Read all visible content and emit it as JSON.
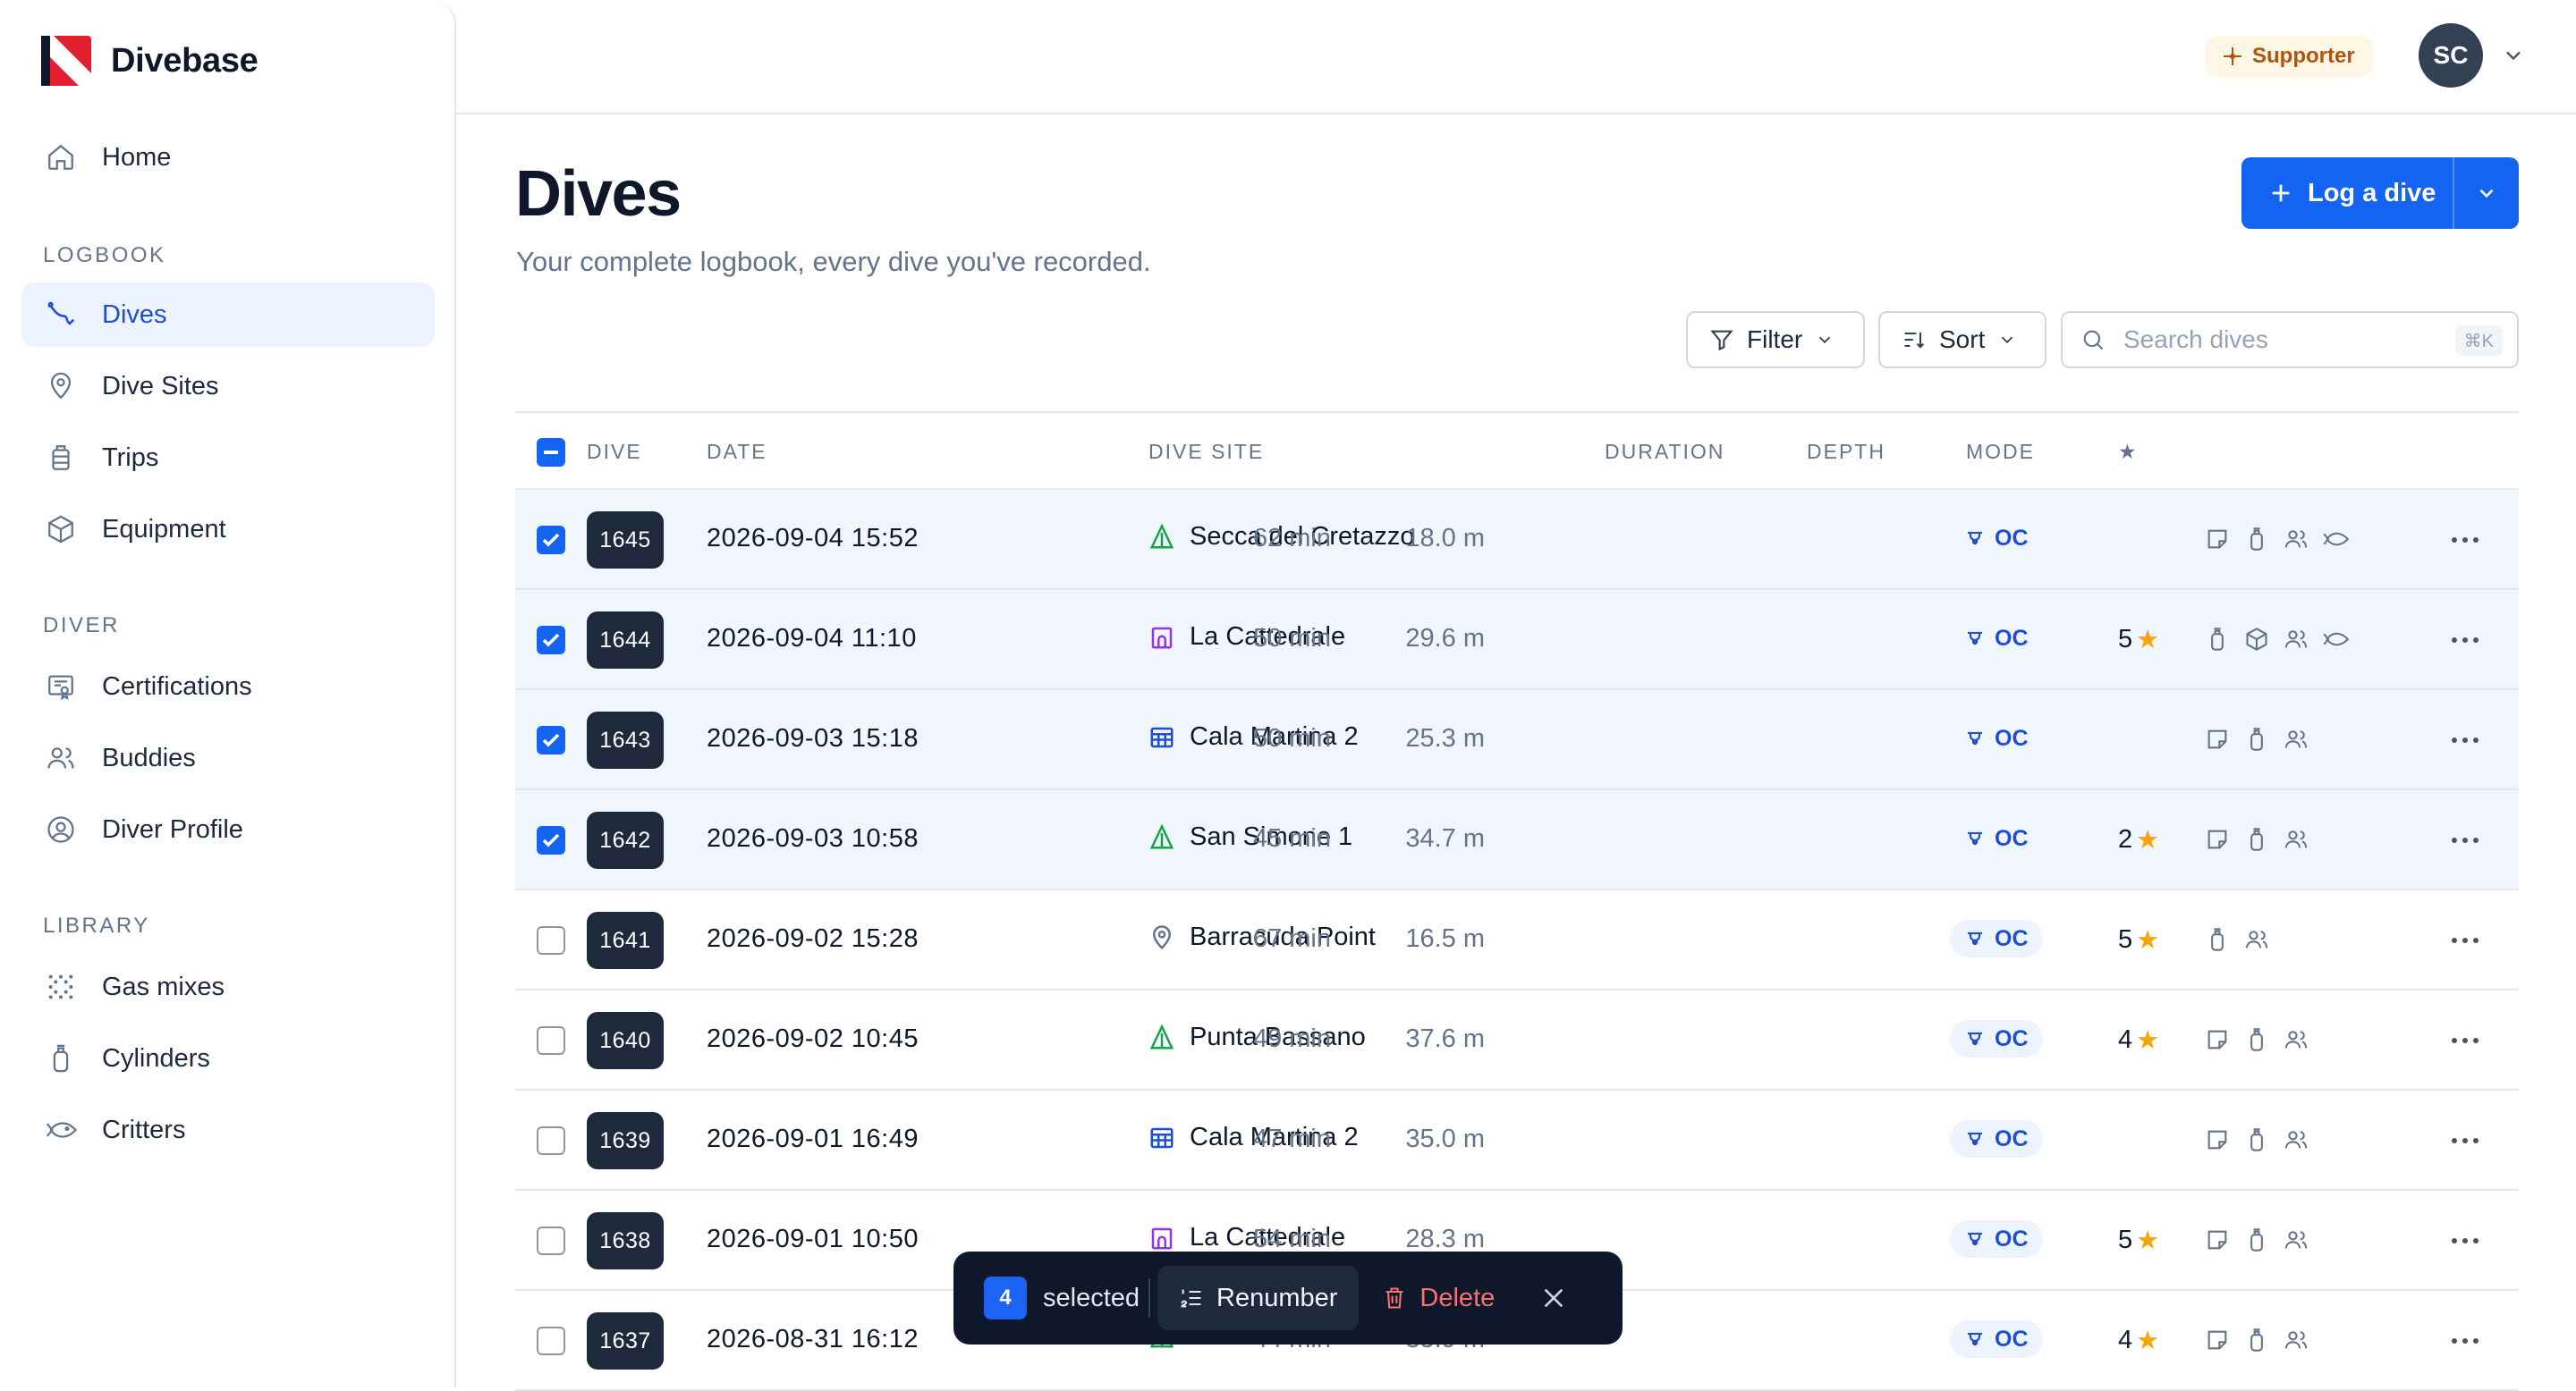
{
  "app": {
    "name": "Divebase"
  },
  "sidebar": {
    "home": "Home",
    "sections": {
      "logbook": "LOGBOOK",
      "diver": "DIVER",
      "library": "LIBRARY"
    },
    "items": [
      {
        "label": "Dives",
        "icon": "dives-icon"
      },
      {
        "label": "Dive Sites",
        "icon": "pin-icon"
      },
      {
        "label": "Trips",
        "icon": "luggage-icon"
      },
      {
        "label": "Equipment",
        "icon": "box-icon"
      },
      {
        "label": "Certifications",
        "icon": "certificate-icon"
      },
      {
        "label": "Buddies",
        "icon": "users-icon"
      },
      {
        "label": "Diver Profile",
        "icon": "user-circle-icon"
      },
      {
        "label": "Gas mixes",
        "icon": "bubbles-icon"
      },
      {
        "label": "Cylinders",
        "icon": "cylinder-icon"
      },
      {
        "label": "Critters",
        "icon": "fish-icon"
      }
    ]
  },
  "header": {
    "badge": "Supporter",
    "avatar_initials": "SC"
  },
  "page": {
    "title": "Dives",
    "subtitle": "Your complete logbook, every dive you've recorded.",
    "log_button": "Log a dive",
    "filter": "Filter",
    "sort": "Sort",
    "search_placeholder": "Search dives",
    "search_shortcut": "⌘K"
  },
  "table": {
    "columns": {
      "dive": "DIVE",
      "date": "DATE",
      "site": "DIVE SITE",
      "duration": "DURATION",
      "depth": "DEPTH",
      "mode": "MODE",
      "rating": "★"
    },
    "rows": [
      {
        "selected": true,
        "number": "1645",
        "date": "2026-09-04 15:52",
        "site_type": "reef",
        "site": "Secca del Cretazzo",
        "duration": "62 min",
        "depth": "18.0 m",
        "mode": "OC",
        "mode_pill": false,
        "rating": "",
        "icons": [
          "note",
          "cylinder",
          "buddies",
          "critters"
        ]
      },
      {
        "selected": true,
        "number": "1644",
        "date": "2026-09-04 11:10",
        "site_type": "cave",
        "site": "La Cattedrale",
        "duration": "50 min",
        "depth": "29.6 m",
        "mode": "OC",
        "mode_pill": false,
        "rating": "5",
        "icons": [
          "cylinder",
          "equipment",
          "buddies",
          "critters"
        ]
      },
      {
        "selected": true,
        "number": "1643",
        "date": "2026-09-03 15:18",
        "site_type": "wreck",
        "site": "Cala Martina 2",
        "duration": "50 min",
        "depth": "25.3 m",
        "mode": "OC",
        "mode_pill": false,
        "rating": "",
        "icons": [
          "note",
          "cylinder",
          "buddies"
        ]
      },
      {
        "selected": true,
        "number": "1642",
        "date": "2026-09-03 10:58",
        "site_type": "reef",
        "site": "San Simone 1",
        "duration": "45 min",
        "depth": "34.7 m",
        "mode": "OC",
        "mode_pill": false,
        "rating": "2",
        "icons": [
          "note",
          "cylinder",
          "buddies"
        ]
      },
      {
        "selected": false,
        "number": "1641",
        "date": "2026-09-02 15:28",
        "site_type": "pin",
        "site": "Barracuda Point",
        "duration": "67 min",
        "depth": "16.5 m",
        "mode": "OC",
        "mode_pill": true,
        "rating": "5",
        "icons": [
          "cylinder",
          "buddies"
        ]
      },
      {
        "selected": false,
        "number": "1640",
        "date": "2026-09-02 10:45",
        "site_type": "reef",
        "site": "Punta Bassano",
        "duration": "49 min",
        "depth": "37.6 m",
        "mode": "OC",
        "mode_pill": true,
        "rating": "4",
        "icons": [
          "note",
          "cylinder",
          "buddies"
        ]
      },
      {
        "selected": false,
        "number": "1639",
        "date": "2026-09-01 16:49",
        "site_type": "wreck",
        "site": "Cala Martina 2",
        "duration": "47 min",
        "depth": "35.0 m",
        "mode": "OC",
        "mode_pill": true,
        "rating": "",
        "icons": [
          "note",
          "cylinder",
          "buddies"
        ]
      },
      {
        "selected": false,
        "number": "1638",
        "date": "2026-09-01 10:50",
        "site_type": "cave",
        "site": "La Cattedrale",
        "duration": "54 min",
        "depth": "28.3 m",
        "mode": "OC",
        "mode_pill": true,
        "rating": "5",
        "icons": [
          "note",
          "cylinder",
          "buddies"
        ]
      },
      {
        "selected": false,
        "number": "1637",
        "date": "2026-08-31 16:12",
        "site_type": "reef",
        "site": "",
        "duration": "44 min",
        "depth": "35.9 m",
        "mode": "OC",
        "mode_pill": true,
        "rating": "4",
        "icons": [
          "note",
          "cylinder",
          "buddies"
        ]
      }
    ]
  },
  "bulk_bar": {
    "count": "4",
    "selected_label": "selected",
    "renumber": "Renumber",
    "delete": "Delete"
  },
  "colors": {
    "primary": "#1464f4",
    "reef": "#16a34a",
    "cave": "#9333ea",
    "wreck": "#1d4ed8",
    "pin": "#64748b",
    "star": "#f5a50b",
    "danger": "#f87171"
  }
}
